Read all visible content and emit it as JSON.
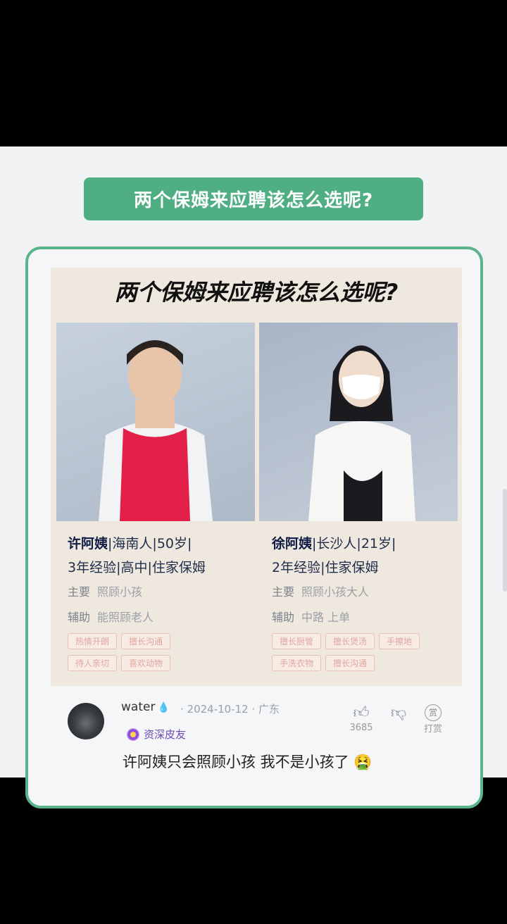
{
  "banner": {
    "title": "两个保姆来应聘该怎么选呢?"
  },
  "poster": {
    "title": "两个保姆来应聘该怎么选呢?",
    "candidates": [
      {
        "name": "许阿姨",
        "line1_rest": "|海南人|50岁|",
        "line2": "3年经验|高中|住家保姆",
        "main_key": "主要",
        "main_val": "照顾小孩",
        "aux_key": "辅助",
        "aux_val": "能照顾老人",
        "tags": [
          "热情开朗",
          "擅长沟通",
          "待人亲切",
          "喜欢动物"
        ]
      },
      {
        "name": "徐阿姨",
        "line1_rest": "|长沙人|21岁|",
        "line2": "2年经验|住家保姆",
        "main_key": "主要",
        "main_val": "照顾小孩大人",
        "aux_key": "辅助",
        "aux_val": "中路 上单",
        "tags": [
          "擅长厨管",
          "擅长煲汤",
          "手擦地",
          "手洗衣物",
          "擅长沟通"
        ]
      }
    ]
  },
  "comment": {
    "username": "water",
    "meta": "· 2024-10-12 · 广东",
    "badge": "资深皮友",
    "text": "许阿姨只会照顾小孩 我不是小孩了",
    "emoji": "🤮",
    "likes": "3685",
    "tip_icon_label": "赏",
    "tip_label": "打赏"
  }
}
